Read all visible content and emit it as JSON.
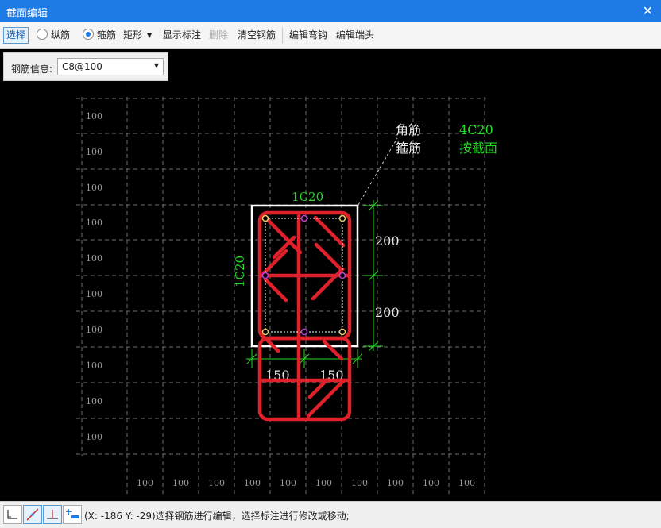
{
  "window": {
    "title": "截面编辑",
    "close": "✕"
  },
  "toolbar": {
    "select": "选择",
    "longitudinal": "纵筋",
    "stirrup": "箍筋",
    "shape": "矩形",
    "show_annotation": "显示标注",
    "delete": "删除",
    "clear_rebar": "清空钢筋",
    "edit_hook": "编辑弯钩",
    "edit_end": "编辑端头"
  },
  "info_panel": {
    "label": "钢筋信息:",
    "value": "C8@100"
  },
  "canvas": {
    "grid_label": "100",
    "corner_label": "角筋",
    "corner_value": "4C20",
    "stirrup_label": "箍筋",
    "stirrup_value": "按截面",
    "top_bar": "1C20",
    "side_bar": "1C20",
    "dim_right_top": "200",
    "dim_right_bottom": "200",
    "dim_bottom_left": "150",
    "dim_bottom_right": "150",
    "colors": {
      "rebar": "#e0202a",
      "dimension": "#22dd22",
      "grid": "#7a7a7a",
      "outline": "#ffffff"
    }
  },
  "status": {
    "text": "(X: -186 Y: -29)选择钢筋进行编辑，选择标注进行修改或移动;"
  }
}
